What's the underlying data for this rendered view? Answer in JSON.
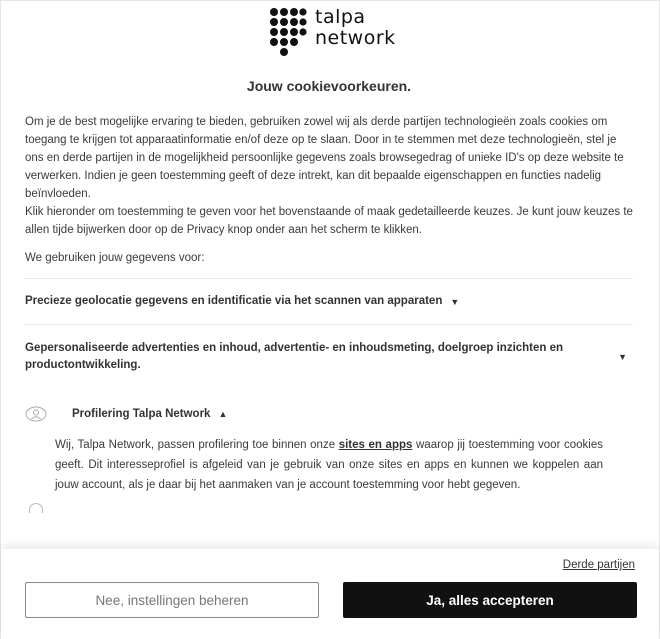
{
  "logo": {
    "line1": "talpa",
    "line2": "network"
  },
  "title": "Jouw cookievoorkeuren.",
  "intro": {
    "paragraph1": "Om je de best mogelijke ervaring te bieden, gebruiken zowel wij als derde partijen technologieën zoals cookies om toegang te krijgen tot apparaatinformatie en/of deze op te slaan. Door in te stemmen met deze technologieën, stel je ons en derde partijen in de mogelijkheid persoonlijke gegevens zoals browsegedrag of unieke ID's op deze website te verwerken. Indien je geen toestemming geeft of deze intrekt, kan dit bepaalde eigenschappen en functies nadelig beïnvloeden.",
    "paragraph2": "Klik hieronder om toestemming te geven voor het bovenstaande of maak gedetailleerde keuzes. Je kunt jouw keuzes te allen tijde bijwerken door op de Privacy knop onder aan het scherm te klikken."
  },
  "use_label": "We gebruiken jouw gegevens voor:",
  "sections": [
    {
      "title": "Precieze geolocatie gegevens en identificatie via het scannen van apparaten"
    },
    {
      "title": "Gepersonaliseerde advertenties en inhoud, advertentie- en inhoudsmeting, doelgroep inzichten en productontwikkeling."
    }
  ],
  "profiling": {
    "title": "Profilering Talpa Network",
    "text_before": "Wij, Talpa Network, passen profilering toe binnen onze ",
    "link": "sites en apps",
    "text_after": " waarop jij toestemming voor cookies geeft. Dit interesseprofiel is afgeleid van je gebruik van onze sites en apps en kunnen we koppelen aan jouw account, als je daar bij het aanmaken van je account toestemming voor hebt gegeven."
  },
  "footer": {
    "third_parties": "Derde partijen",
    "manage_button": "Nee, instellingen beheren",
    "accept_button": "Ja, alles accepteren"
  },
  "colors": {
    "accept_bg": "#111111",
    "manage_border": "#8a8a8a",
    "text": "#333333"
  }
}
